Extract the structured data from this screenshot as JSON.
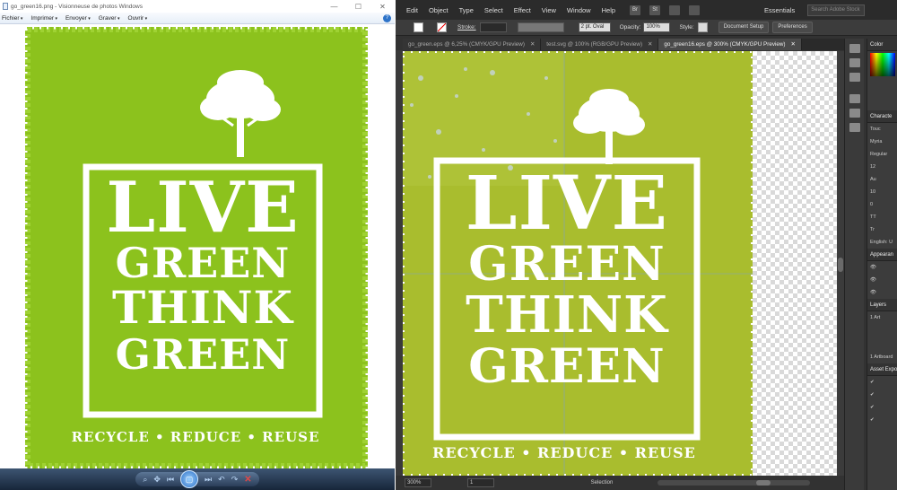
{
  "viewer": {
    "title": "go_green16.png - Visionneuse de photos Windows",
    "win_buttons": [
      "—",
      "☐",
      "✕"
    ],
    "menu": [
      "Fichier",
      "Imprimer",
      "Envoyer",
      "Graver",
      "Ouvrir"
    ],
    "help": "?",
    "toolbar": [
      "⌕",
      "✥",
      "⏮",
      "⏭",
      "↶",
      "↷",
      "✕"
    ],
    "play": "▢"
  },
  "poster": {
    "line1": "LIVE",
    "line2": "GREEN",
    "line3": "THINK",
    "line4": "GREEN",
    "tagline": "RECYCLE • REDUCE • REUSE",
    "colors": {
      "left_bg": "#8cc21d",
      "right_bg": "#a9bd2e",
      "ink": "#ffffff"
    }
  },
  "illustrator": {
    "menu": [
      "Edit",
      "Object",
      "Type",
      "Select",
      "Effect",
      "View",
      "Window",
      "Help"
    ],
    "menu_icons": [
      "Br",
      "St"
    ],
    "workspace": "Essentials",
    "search_placeholder": "Search Adobe Stock",
    "control_bar": {
      "stroke_label": "Stroke:",
      "brush": "2 pt. Oval",
      "opacity_label": "Opacity:",
      "opacity_value": "100%",
      "style_label": "Style:",
      "doc_setup": "Document Setup",
      "preferences": "Preferences"
    },
    "tabs": [
      {
        "label": "go_green.eps @ 6,25% (CMYK/GPU Preview)",
        "active": false
      },
      {
        "label": "test.svg @ 100% (RGB/GPU Preview)",
        "active": false
      },
      {
        "label": "go_green16.eps @ 300% (CMYK/GPU Preview)",
        "active": true
      }
    ],
    "tab_close": "✕",
    "status": {
      "zoom": "300%",
      "artboard": "1",
      "tool": "Selection"
    },
    "panels": {
      "color": "Color",
      "character": "Characte",
      "font": "Myria",
      "font_style": "Regular",
      "font_size": "12",
      "leading": "Au",
      "tracking": "10",
      "rotation": "0",
      "touch": "Touc",
      "tt": "TT",
      "tr": "Tr",
      "language": "English: U",
      "appearance": "Appearan",
      "layers": "Layers",
      "layer_name": "Art",
      "layer_index": "1",
      "artboard_count": "1 Artboard",
      "asset_export": "Asset Expo"
    }
  }
}
